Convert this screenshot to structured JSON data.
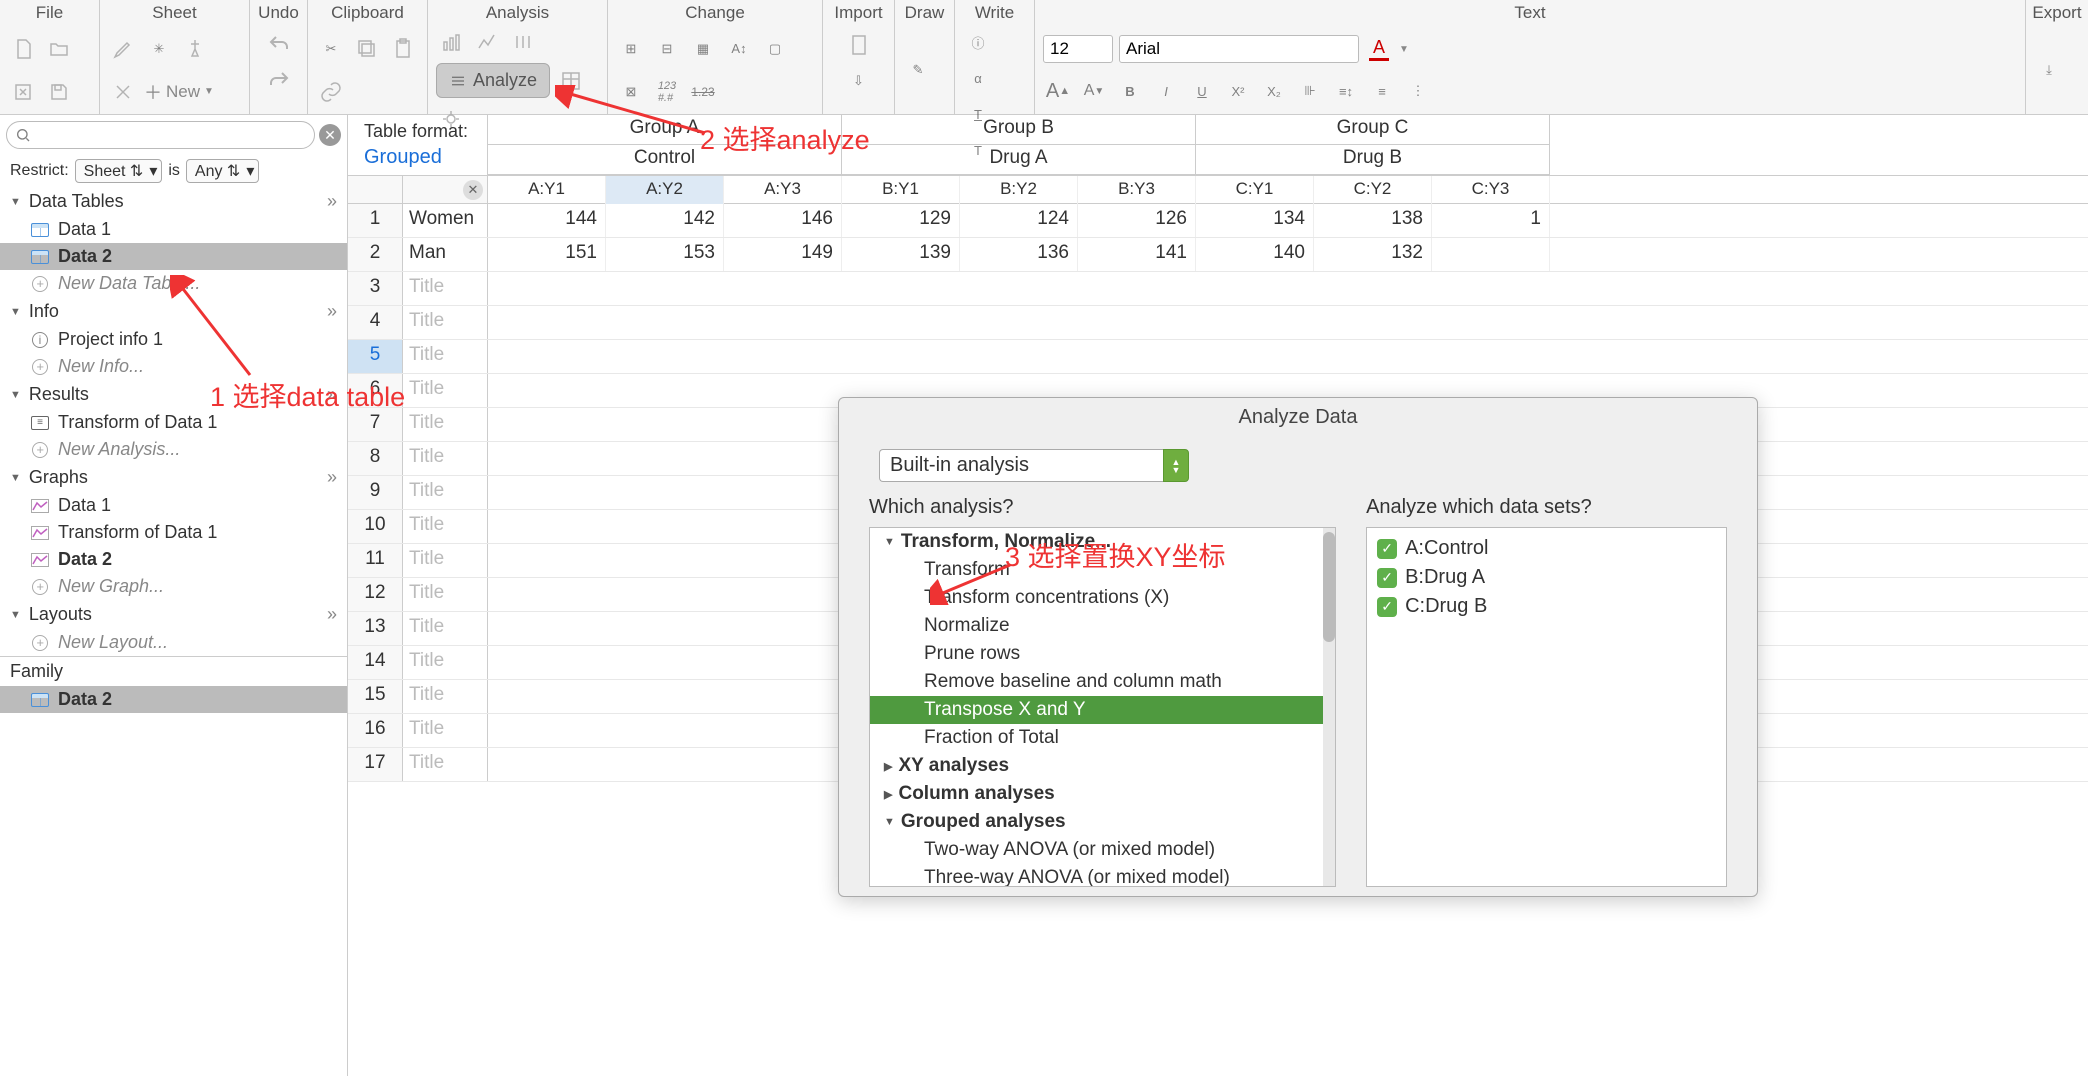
{
  "toolbar": {
    "sections": [
      "File",
      "Sheet",
      "Undo",
      "Clipboard",
      "Analysis",
      "Change",
      "Import",
      "Draw",
      "Write",
      "Text",
      "Export"
    ],
    "new_label": "New",
    "analyze_label": "Analyze",
    "font_size": "12",
    "font_name": "Arial"
  },
  "search": {
    "placeholder": ""
  },
  "restrict": {
    "label": "Restrict:",
    "scope": "Sheet",
    "verb": "is",
    "value": "Any"
  },
  "nav": {
    "data_tables": {
      "title": "Data Tables",
      "items": [
        "Data 1",
        "Data 2"
      ],
      "new": "New Data Table..."
    },
    "info": {
      "title": "Info",
      "items": [
        "Project info 1"
      ],
      "new": "New Info..."
    },
    "results": {
      "title": "Results",
      "items": [
        "Transform of Data 1"
      ],
      "new": "New Analysis..."
    },
    "graphs": {
      "title": "Graphs",
      "items": [
        "Data 1",
        "Transform of Data 1",
        "Data 2"
      ],
      "new": "New Graph..."
    },
    "layouts": {
      "title": "Layouts",
      "new": "New Layout..."
    },
    "family": {
      "title": "Family",
      "items": [
        "Data 2"
      ]
    }
  },
  "table_format": {
    "label": "Table format:",
    "value": "Grouped"
  },
  "groups": [
    {
      "title": "Group A",
      "sub": "Control",
      "cols": [
        "A:Y1",
        "A:Y2",
        "A:Y3"
      ]
    },
    {
      "title": "Group B",
      "sub": "Drug A",
      "cols": [
        "B:Y1",
        "B:Y2",
        "B:Y3"
      ]
    },
    {
      "title": "Group C",
      "sub": "Drug B",
      "cols": [
        "C:Y1",
        "C:Y2",
        "C:Y3"
      ]
    }
  ],
  "rows": [
    {
      "n": "1",
      "label": "Women",
      "vals": [
        "144",
        "142",
        "146",
        "129",
        "124",
        "126",
        "134",
        "138",
        "1"
      ]
    },
    {
      "n": "2",
      "label": "Man",
      "vals": [
        "151",
        "153",
        "149",
        "139",
        "136",
        "141",
        "140",
        "132",
        ""
      ]
    }
  ],
  "empty_rows": [
    {
      "n": "3",
      "ph": "Title"
    },
    {
      "n": "4",
      "ph": "Title"
    },
    {
      "n": "5",
      "ph": "Title"
    },
    {
      "n": "6",
      "ph": "Title"
    },
    {
      "n": "7",
      "ph": "Title"
    },
    {
      "n": "8",
      "ph": "Title"
    },
    {
      "n": "9",
      "ph": "Title"
    },
    {
      "n": "10",
      "ph": "Title"
    },
    {
      "n": "11",
      "ph": "Title"
    },
    {
      "n": "12",
      "ph": "Title"
    },
    {
      "n": "13",
      "ph": "Title"
    },
    {
      "n": "14",
      "ph": "Title"
    },
    {
      "n": "15",
      "ph": "Title"
    },
    {
      "n": "16",
      "ph": "Title"
    },
    {
      "n": "17",
      "ph": "Title"
    }
  ],
  "dialog": {
    "title": "Analyze Data",
    "combo": "Built-in analysis",
    "which_analysis": "Which analysis?",
    "which_datasets": "Analyze which data sets?",
    "tree": {
      "g1": "Transform, Normalize...",
      "g1_items": [
        "Transform",
        "Transform concentrations (X)",
        "Normalize",
        "Prune rows",
        "Remove baseline and column math",
        "Transpose X and Y",
        "Fraction of Total"
      ],
      "g2": "XY analyses",
      "g3": "Column analyses",
      "g4": "Grouped analyses",
      "g4_items": [
        "Two-way ANOVA (or mixed model)",
        "Three-way ANOVA (or mixed model)"
      ]
    },
    "datasets": [
      "A:Control",
      "B:Drug A",
      "C:Drug B"
    ]
  },
  "annotations": {
    "a1": "1 选择data table",
    "a2": "2 选择analyze",
    "a3": "3 选择置换XY坐标"
  }
}
